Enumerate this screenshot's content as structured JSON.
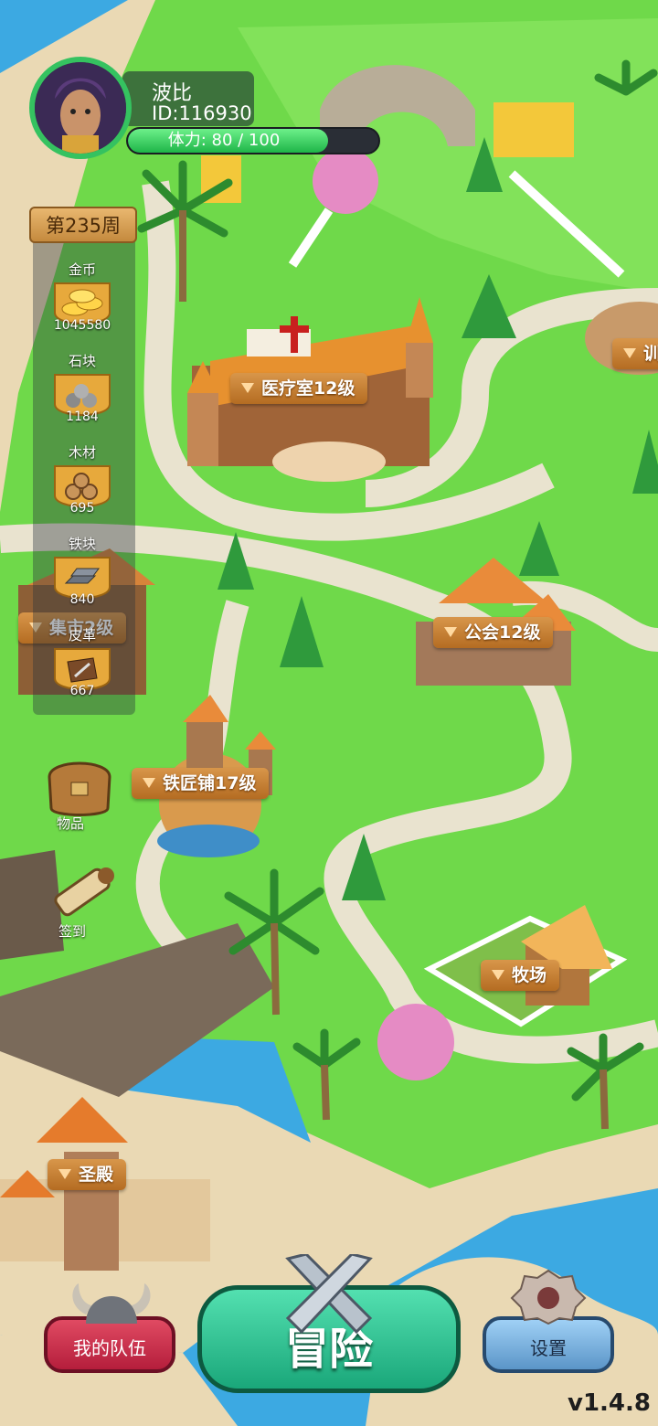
{
  "player": {
    "name": "波比",
    "id_text": "ID:116930",
    "stamina_text": "体力: 80 / 100",
    "stamina_fraction": 0.8
  },
  "week": "第235周",
  "resources": [
    {
      "label": "金币",
      "value": "1045580",
      "icon": "gold-coins-icon"
    },
    {
      "label": "石块",
      "value": "1184",
      "icon": "stones-icon"
    },
    {
      "label": "木材",
      "value": "695",
      "icon": "wood-logs-icon"
    },
    {
      "label": "铁块",
      "value": "840",
      "icon": "iron-ingot-icon"
    },
    {
      "label": "皮革",
      "value": "667",
      "icon": "leather-icon"
    }
  ],
  "buildings": {
    "infirmary": "医疗室12级",
    "guild": "公会12级",
    "blacksmith": "铁匠铺17级",
    "ranch": "牧场",
    "temple": "圣殿",
    "partial_left": "集市2级",
    "partial_right": "训"
  },
  "side_buttons": {
    "items": "物品",
    "checkin": "签到"
  },
  "bottom": {
    "team": "我的队伍",
    "adventure": "冒险",
    "settings": "设置"
  },
  "version": "v1.4.8"
}
